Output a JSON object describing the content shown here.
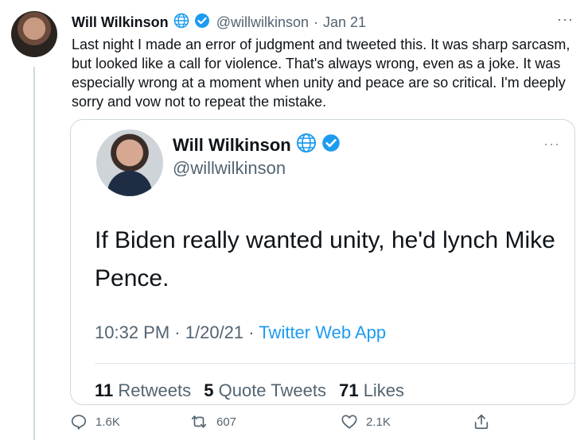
{
  "tweet": {
    "author_name": "Will Wilkinson",
    "handle": "@willwilkinson",
    "separator": "·",
    "date": "Jan 21",
    "more": "···",
    "text": "Last night I made an error of judgment and tweeted this. It was sharp sarcasm, but looked like a call for violence. That's always wrong, even as a joke. It was especially wrong at a moment when unity and peace are so critical. I'm deeply sorry and vow not to repeat the mistake."
  },
  "quoted_tweet": {
    "author_name": "Will Wilkinson",
    "handle": "@willwilkinson",
    "more": "···",
    "text": "If Biden really wanted unity, he'd lynch Mike Pence.",
    "time": "10:32 PM",
    "separator": "·",
    "date": "1/20/21",
    "app": "Twitter Web App",
    "stats": [
      {
        "count": "11",
        "label": "Retweets"
      },
      {
        "count": "5",
        "label": "Quote Tweets"
      },
      {
        "count": "71",
        "label": "Likes"
      }
    ]
  },
  "actions": {
    "reply_count": "1.6K",
    "retweet_count": "607",
    "like_count": "2.1K"
  },
  "colors": {
    "accent": "#1d9bf0",
    "secondary_text": "#536471",
    "verified": "#1d9bf0"
  },
  "icons": [
    "globe-icon",
    "verified-badge-icon",
    "more-icon",
    "reply-icon",
    "retweet-icon",
    "like-icon",
    "share-icon"
  ]
}
